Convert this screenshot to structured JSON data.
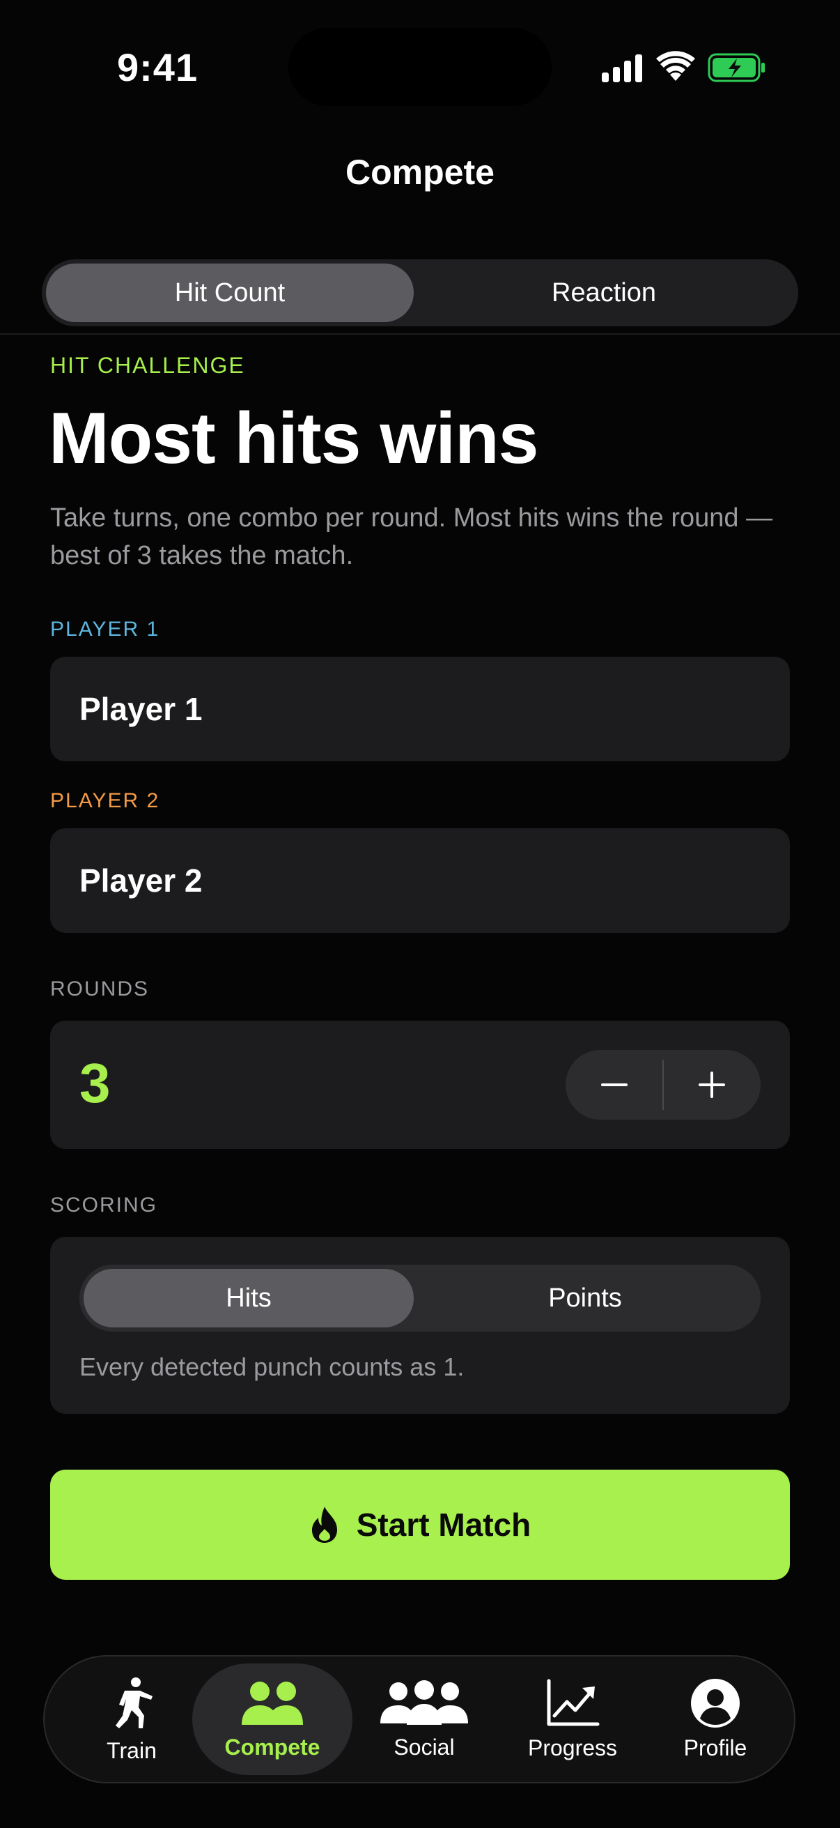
{
  "status": {
    "time": "9:41"
  },
  "nav": {
    "title": "Compete"
  },
  "mode_tabs": [
    {
      "label": "Hit Count",
      "active": true
    },
    {
      "label": "Reaction",
      "active": false
    }
  ],
  "challenge": {
    "eyebrow": "HIT CHALLENGE",
    "title": "Most hits wins",
    "description": "Take turns, one combo per round. Most hits wins the round — best of 3 takes the match."
  },
  "players": {
    "p1_label": "PLAYER 1",
    "p1_value": "Player 1",
    "p2_label": "PLAYER 2",
    "p2_value": "Player 2"
  },
  "rounds": {
    "label": "ROUNDS",
    "value": "3"
  },
  "scoring": {
    "label": "SCORING",
    "options": [
      {
        "label": "Hits",
        "active": true
      },
      {
        "label": "Points",
        "active": false
      }
    ],
    "note": "Every detected punch counts as 1."
  },
  "cta": {
    "label": "Start Match",
    "icon": "flame-icon"
  },
  "tabbar": [
    {
      "label": "Train",
      "icon": "train-icon",
      "active": false
    },
    {
      "label": "Compete",
      "icon": "compete-icon",
      "active": true
    },
    {
      "label": "Social",
      "icon": "social-icon",
      "active": false
    },
    {
      "label": "Progress",
      "icon": "progress-icon",
      "active": false
    },
    {
      "label": "Profile",
      "icon": "profile-icon",
      "active": false
    }
  ],
  "colors": {
    "accent": "#a8f04e",
    "player1": "#5fb5dd",
    "player2": "#f39a48",
    "background": "#050505",
    "card": "#1c1c1e"
  }
}
